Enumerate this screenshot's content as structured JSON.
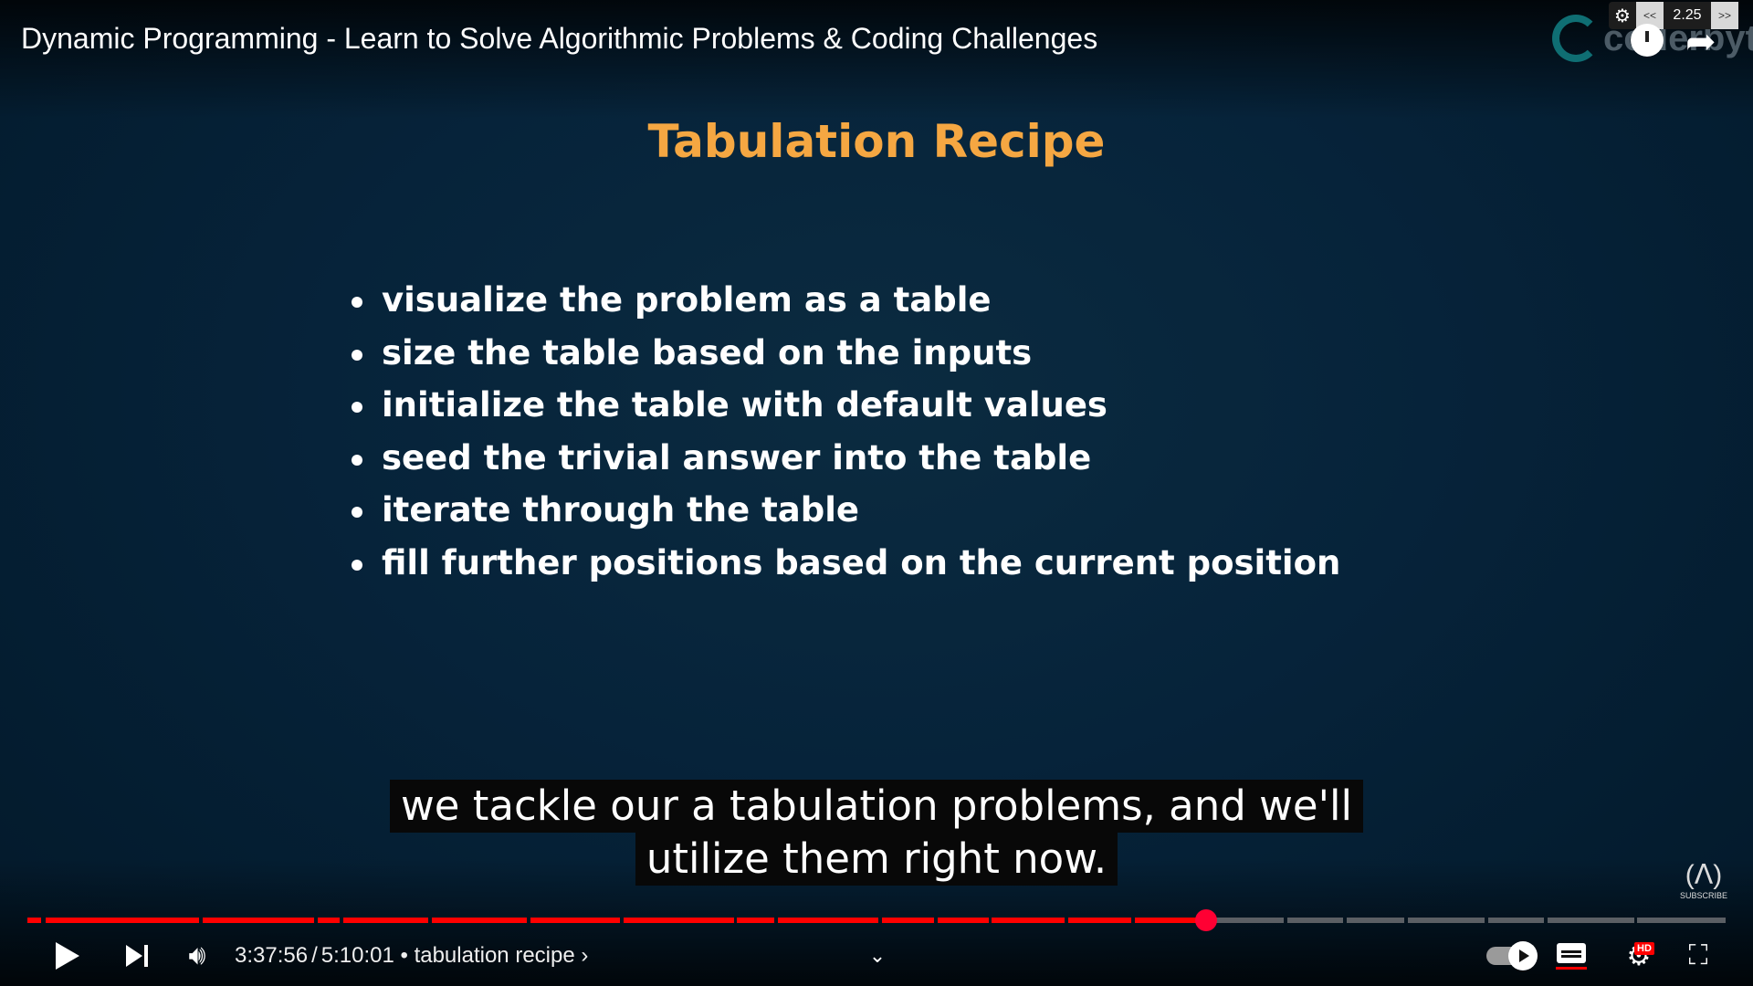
{
  "video": {
    "title": "Dynamic Programming - Learn to Solve Algorithmic Problems & Coding Challenges"
  },
  "overlay": {
    "channel_watermark": "coderbyte",
    "speed_widget": {
      "prev_label": "<<",
      "value": "2.25",
      "next_label": ">>"
    }
  },
  "slide": {
    "title": "Tabulation Recipe",
    "bullets": [
      "visualize the problem as a table",
      "size the table based on the inputs",
      "initialize the table with default values",
      "seed the trivial answer into the table",
      "iterate through the table",
      "fill further positions based on the current position"
    ]
  },
  "captions": {
    "lines": [
      "we tackle our a tabulation problems, and we'll",
      "utilize them right now."
    ]
  },
  "subscribe_badge": {
    "label": "SUBSCRIBE"
  },
  "player": {
    "current_time": "3:37:56",
    "separator": "/",
    "duration": "5:10:01",
    "chapter_title": "• tabulation recipe",
    "chapter_chevron": "›",
    "progress_fraction": 0.694,
    "hd_badge": "HD",
    "colors": {
      "progress_played": "#ff0000",
      "progress_unplayed": "#5b5f64",
      "scrubber": "#ff0033",
      "slide_title": "#f5a742"
    },
    "chapters": [
      {
        "start": 0.0,
        "end": 0.008
      },
      {
        "start": 0.011,
        "end": 0.101
      },
      {
        "start": 0.103,
        "end": 0.169
      },
      {
        "start": 0.171,
        "end": 0.184
      },
      {
        "start": 0.186,
        "end": 0.236
      },
      {
        "start": 0.238,
        "end": 0.294
      },
      {
        "start": 0.296,
        "end": 0.349
      },
      {
        "start": 0.351,
        "end": 0.416
      },
      {
        "start": 0.418,
        "end": 0.44
      },
      {
        "start": 0.442,
        "end": 0.501
      },
      {
        "start": 0.503,
        "end": 0.534
      },
      {
        "start": 0.536,
        "end": 0.566
      },
      {
        "start": 0.568,
        "end": 0.611
      },
      {
        "start": 0.613,
        "end": 0.65
      },
      {
        "start": 0.652,
        "end": 0.69
      },
      {
        "start": 0.692,
        "end": 0.74
      },
      {
        "start": 0.742,
        "end": 0.775
      },
      {
        "start": 0.777,
        "end": 0.811
      },
      {
        "start": 0.813,
        "end": 0.858
      },
      {
        "start": 0.86,
        "end": 0.893
      },
      {
        "start": 0.895,
        "end": 0.946
      },
      {
        "start": 0.948,
        "end": 1.0
      }
    ],
    "icons": {
      "play": "play-icon",
      "next": "skip-next-icon",
      "volume": "volume-icon",
      "chevron": "chevron-down-icon",
      "autoplay": "autoplay-toggle-icon",
      "captions": "closed-captions-icon",
      "settings": "gear-icon",
      "fullscreen": "fullscreen-exit-icon"
    }
  }
}
